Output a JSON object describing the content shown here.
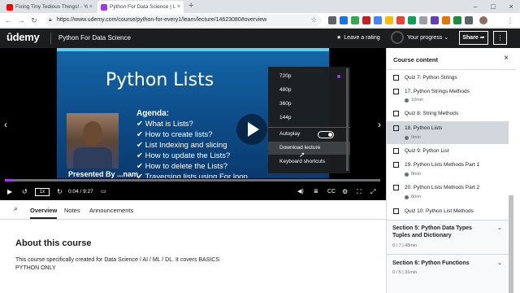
{
  "browser": {
    "tabs": [
      {
        "title": "Fixing Tiny Tedious Things! - Yo...",
        "close": "×"
      },
      {
        "title": "Python For Data Science | Udemy",
        "close": "×"
      }
    ],
    "newtab": "+",
    "controls": {
      "minimize": "–",
      "maximize": "□",
      "close": "×"
    },
    "url": "https://www.udemy.com/course/python-for-every1/learn/lecture/14623080#overview",
    "back": "←",
    "forward": "→",
    "reload": "↻",
    "colors": {
      "yt": "#ff0000",
      "udemy": "#a435f0"
    }
  },
  "header": {
    "logo": "ûdemy",
    "course_title": "Python For Data Science",
    "rate_label": "Leave a rating",
    "progress_label": "Your progress",
    "progress_chev": "⌄",
    "share_label": "Share ➦",
    "more_label": "⋮"
  },
  "video": {
    "slide_title": "Python Lists",
    "agenda_heading": "Agenda:",
    "agenda": [
      "What is Lists?",
      "How to create lists?",
      "List Indexing and slicing",
      "How to update the Lists?",
      "How to delete the Lists?",
      "Traversing lists using For loop"
    ],
    "presenter": "Presented By",
    "presenter_suffix": "...nam",
    "prev_arrow": "‹",
    "next_arrow": "›",
    "progress": 0.02,
    "controls": {
      "play": "▶",
      "rewind": "↺",
      "speed": "1x",
      "forward": "↻",
      "time": "0:04 / 9:27",
      "note": "▭",
      "volume": "◀)",
      "settings": "⚙",
      "fullscreen": "⛶"
    }
  },
  "settings_menu": {
    "qualities": [
      "720p",
      "480p",
      "360p",
      "144p"
    ],
    "selected": "720p",
    "autoplay": "Autoplay",
    "download": "Download lecture",
    "shortcuts": "Keyboard shortcuts"
  },
  "page_tabs": {
    "search": "⌕",
    "items": [
      "Overview",
      "Notes",
      "Announcements"
    ],
    "active": "Overview"
  },
  "about": {
    "heading": "About this course",
    "line1": "This course specifically created for Data Science / AI / ML / DL. It covers BASICS",
    "line2": "PYTHON ONLY"
  },
  "sidebar": {
    "title": "Course content",
    "close": "×",
    "items": [
      {
        "label": "Quiz 7: Python Strings",
        "duration": ""
      },
      {
        "label": "17. Python Strings Methods",
        "duration": "10min"
      },
      {
        "label": "Quiz 8: String Methods",
        "duration": ""
      },
      {
        "label": "18. Python Lists",
        "duration": "9min"
      },
      {
        "label": "Quiz 9: Python List",
        "duration": ""
      },
      {
        "label": "19. Python Lists Methods Part 1",
        "duration": "8min"
      },
      {
        "label": "20. Python Lists Methods Part 2",
        "duration": "8min"
      },
      {
        "label": "Quiz 10: Python List Methods",
        "duration": ""
      }
    ],
    "current_index": 3,
    "sections": [
      {
        "title": "Section 5: Python Data Types Tuples and Dictionary",
        "meta": "0 / 7 | 48min",
        "chev": "⌄"
      },
      {
        "title": "Section 6: Python Functions",
        "meta": "0 / 5 | 31min",
        "chev": "⌄"
      }
    ]
  }
}
